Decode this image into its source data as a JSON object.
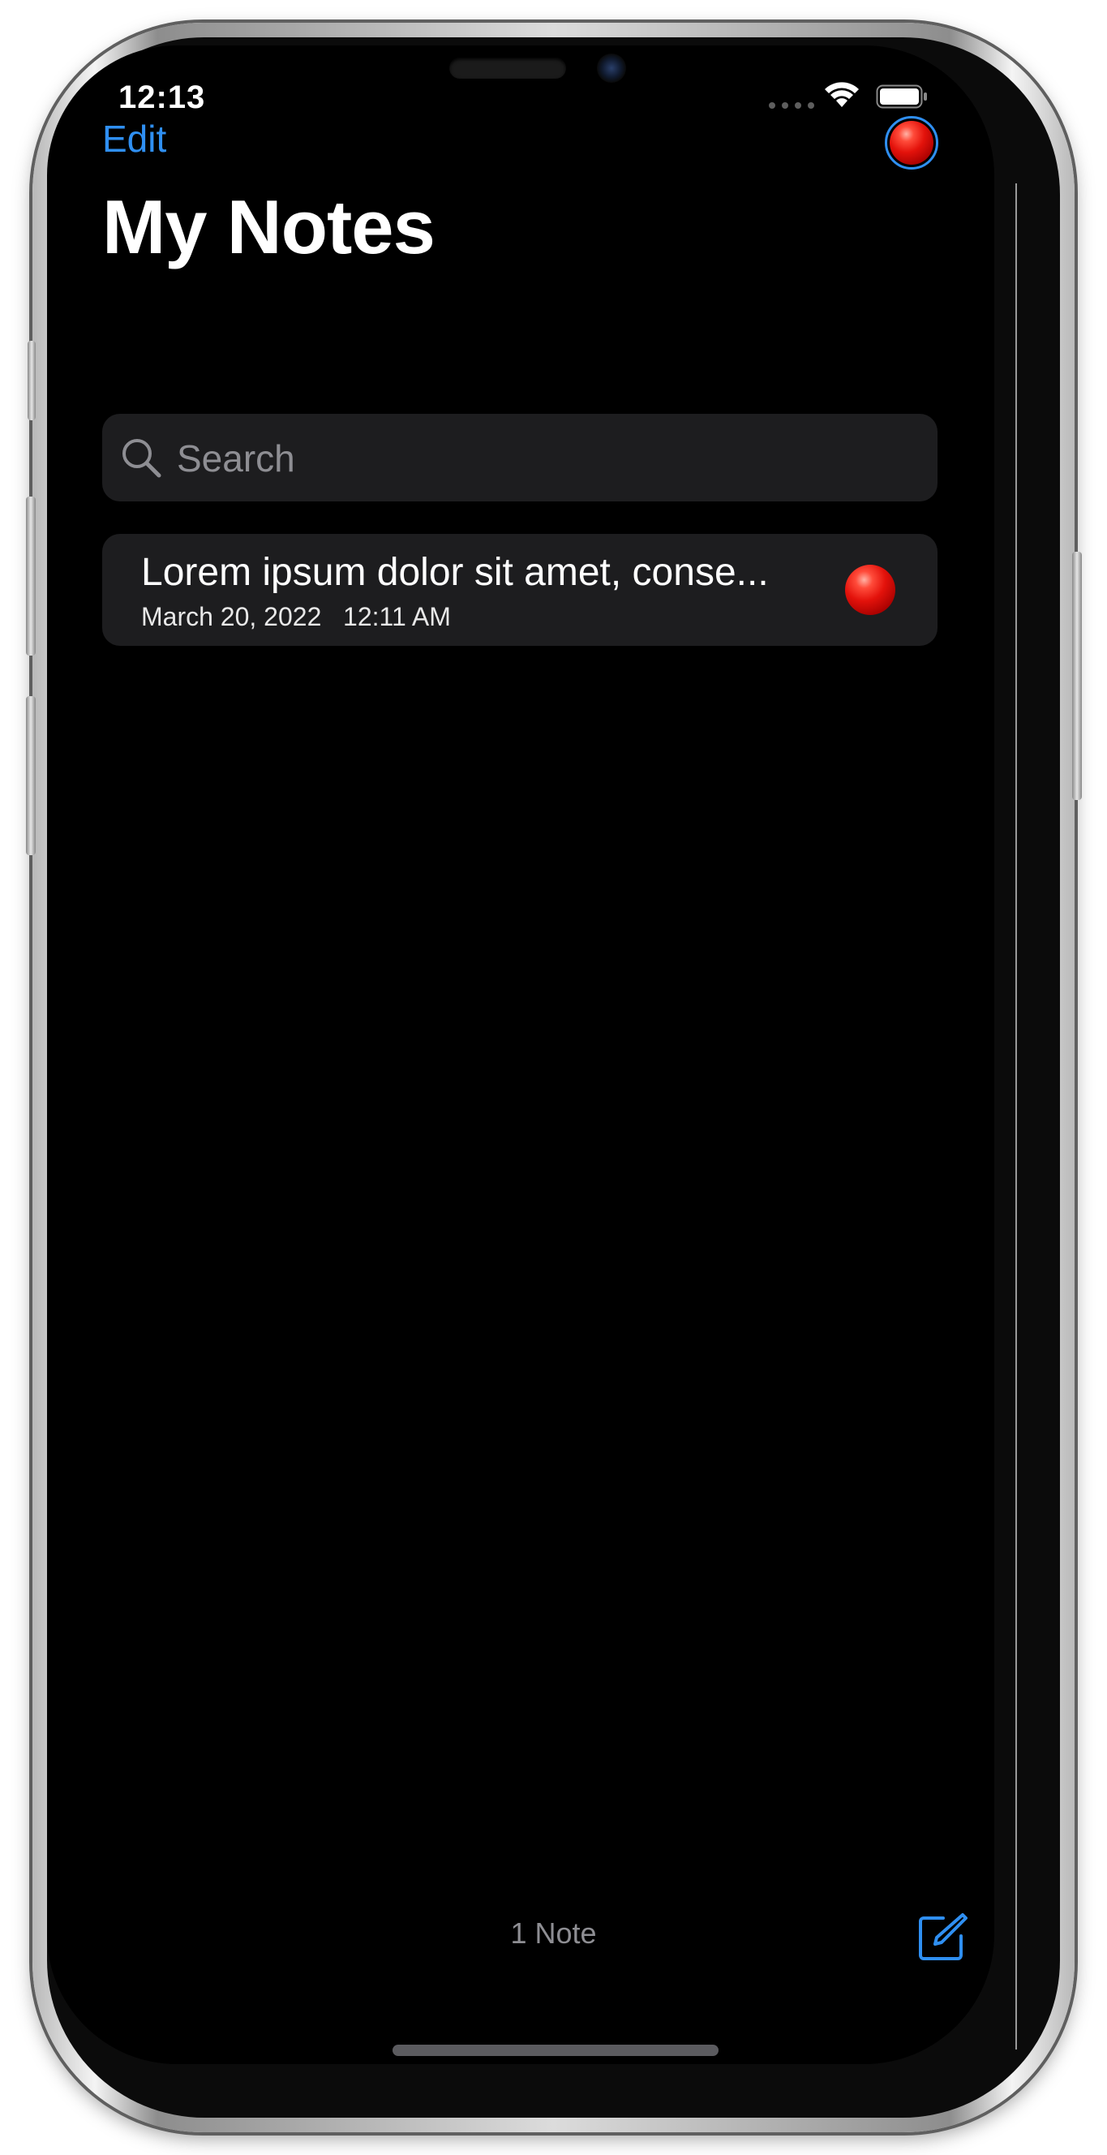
{
  "status_bar": {
    "time": "12:13",
    "signal_icon": "cellular-dots-icon",
    "wifi_icon": "wifi-icon",
    "battery_icon": "battery-full-icon"
  },
  "nav": {
    "edit_label": "Edit",
    "filter_icon": "red-ball-icon"
  },
  "page_title": "My Notes",
  "search": {
    "icon": "search-icon",
    "placeholder": "Search"
  },
  "notes": [
    {
      "title": "Lorem ipsum dolor sit amet, conse...",
      "date": "March 20, 2022   12:11 AM",
      "flag_icon": "red-ball-icon"
    }
  ],
  "toolbar": {
    "count_label": "1 Note",
    "compose_icon": "compose-icon"
  },
  "colors": {
    "accent": "#2f8ff2",
    "background": "#000000",
    "cell": "#1d1d1f",
    "secondary_text": "#8e8e93"
  }
}
